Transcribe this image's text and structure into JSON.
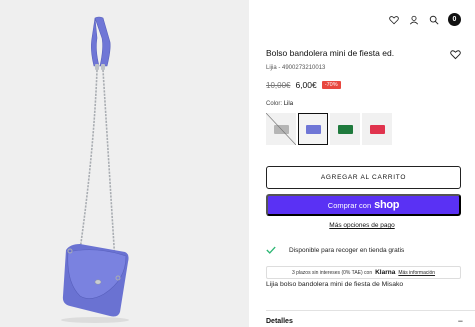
{
  "header": {
    "icons": [
      "heart-icon",
      "user-icon",
      "search-icon",
      "bag-icon"
    ],
    "cart_count": "0"
  },
  "product": {
    "title": "Bolso bandolera mini de fiesta ed.",
    "sku": "Lijia - 4900273210013",
    "old_price": "10,00€",
    "new_price": "6,00€",
    "discount": "-70%",
    "color_label": "Color:",
    "color_value": "Lila",
    "description": "Lijia bolso bandolera mini de fiesta de Misako"
  },
  "swatches": [
    {
      "color": "silver",
      "hex": "#b5b5b5",
      "unavailable": true
    },
    {
      "color": "lila",
      "hex": "#6f76d6",
      "selected": true
    },
    {
      "color": "green",
      "hex": "#1f7a3d"
    },
    {
      "color": "red",
      "hex": "#e0334d"
    }
  ],
  "buttons": {
    "add_to_cart": "AGREGAR AL CARRITO",
    "shop_pay_prefix": "Comprar con",
    "shop_pay_logo": "shop",
    "more_options": "Más opciones de pago"
  },
  "pickup": {
    "text": "Disponible para recoger en tienda gratis"
  },
  "klarna": {
    "text": "3 plazos sin intereses (0% TAE) con",
    "brand": "Klarna",
    "link": "Más información"
  },
  "details": {
    "label": "Detalles",
    "toggle": "−"
  },
  "colors": {
    "accent": "#5a31f4",
    "discount": "#e8473f",
    "check": "#2bb673",
    "bag": "#6f76d6",
    "gallery_bg": "#efefef"
  }
}
